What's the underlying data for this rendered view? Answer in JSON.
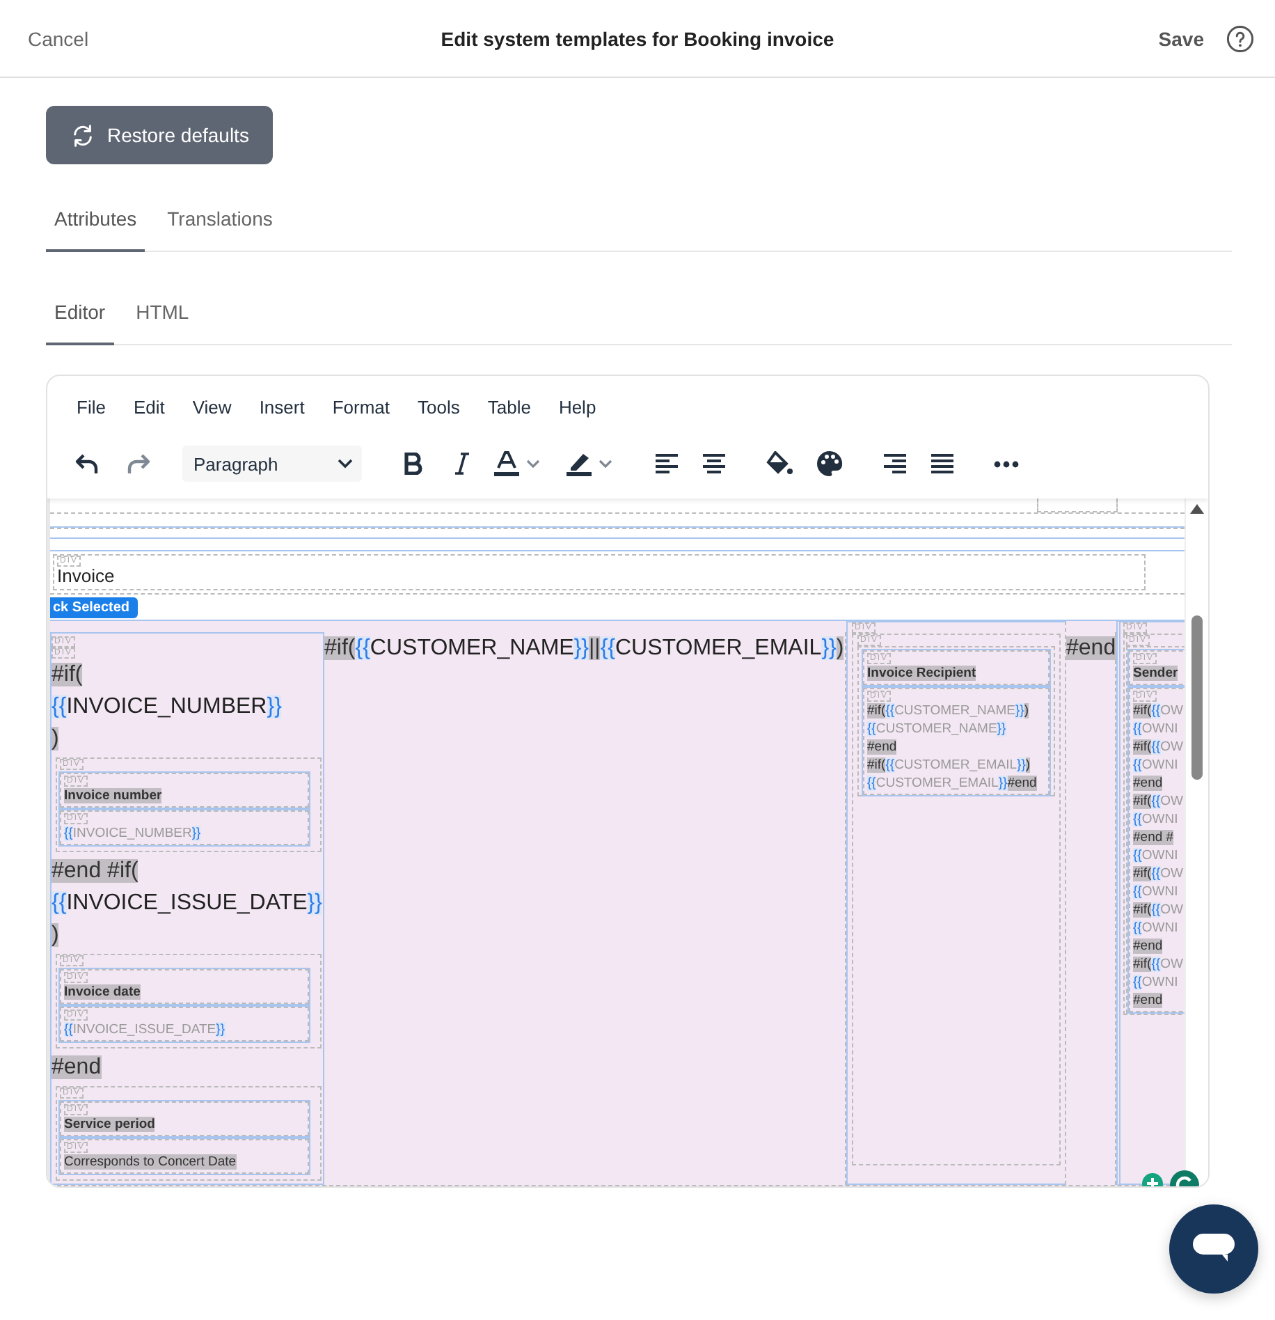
{
  "header": {
    "cancel": "Cancel",
    "title": "Edit system templates for Booking invoice",
    "save": "Save"
  },
  "restore_button": "Restore defaults",
  "section_tabs": [
    {
      "label": "Attributes",
      "selected": true
    },
    {
      "label": "Translations",
      "selected": false
    }
  ],
  "editor_tabs": [
    {
      "label": "Editor",
      "selected": true
    },
    {
      "label": "HTML",
      "selected": false
    }
  ],
  "editor": {
    "menu": [
      "File",
      "Edit",
      "View",
      "Insert",
      "Format",
      "Tools",
      "Table",
      "Help"
    ],
    "block_format": "Paragraph",
    "selection_badge": "ck Selected",
    "title_block": {
      "tag": "DIV",
      "text": "Invoice"
    },
    "left_tags": [
      "DIV",
      "DIV"
    ],
    "left_column": [
      {
        "kind": "line",
        "parts": [
          {
            "kind": "code",
            "text": "#if("
          }
        ]
      },
      {
        "kind": "line",
        "parts": [
          {
            "kind": "brace",
            "text": "{{"
          },
          {
            "kind": "var",
            "text": "INVOICE_NUMBER"
          },
          {
            "kind": "brace",
            "text": "}}"
          }
        ]
      },
      {
        "kind": "line",
        "parts": [
          {
            "kind": "code",
            "text": ")"
          }
        ]
      },
      {
        "kind": "group",
        "tag": "DIV",
        "fields": [
          {
            "kind": "label",
            "tag": "DIV",
            "lines": [
              [
                {
                  "kind": "code",
                  "text": "Invoice number"
                }
              ]
            ]
          },
          {
            "kind": "value",
            "tag": "DIV",
            "lines": [
              [
                {
                  "kind": "brace",
                  "text": "{{"
                },
                {
                  "kind": "var",
                  "text": "INVOICE_NUMBER"
                },
                {
                  "kind": "brace",
                  "text": "}}"
                }
              ]
            ]
          }
        ]
      },
      {
        "kind": "line",
        "parts": [
          {
            "kind": "code",
            "text": "#end #if("
          }
        ]
      },
      {
        "kind": "line",
        "parts": [
          {
            "kind": "brace",
            "text": "{{"
          },
          {
            "kind": "var",
            "text": "INVOICE_ISSUE_DATE"
          },
          {
            "kind": "brace",
            "text": "}}"
          }
        ]
      },
      {
        "kind": "line",
        "parts": [
          {
            "kind": "code",
            "text": ")"
          }
        ]
      },
      {
        "kind": "group",
        "tag": "DIV",
        "fields": [
          {
            "kind": "label",
            "tag": "DIV",
            "lines": [
              [
                {
                  "kind": "code",
                  "text": "Invoice date"
                }
              ]
            ]
          },
          {
            "kind": "value",
            "tag": "DIV",
            "lines": [
              [
                {
                  "kind": "brace",
                  "text": "{{"
                },
                {
                  "kind": "var",
                  "text": "INVOICE_ISSUE_DATE"
                },
                {
                  "kind": "brace",
                  "text": "}}"
                }
              ]
            ]
          }
        ]
      },
      {
        "kind": "line",
        "parts": [
          {
            "kind": "code",
            "text": "#end"
          }
        ]
      },
      {
        "kind": "group",
        "tag": "DIV",
        "fields": [
          {
            "kind": "label",
            "tag": "DIV",
            "lines": [
              [
                {
                  "kind": "code",
                  "text": "Service period"
                }
              ]
            ]
          },
          {
            "kind": "value",
            "tag": "DIV",
            "lines": [
              [
                {
                  "kind": "code",
                  "text": "Corresponds to Concert Date"
                }
              ]
            ]
          }
        ]
      }
    ],
    "middle_line": [
      {
        "kind": "code",
        "text": "#if("
      },
      {
        "kind": "brace",
        "text": "{{"
      },
      {
        "kind": "var",
        "text": "CUSTOMER_NAME"
      },
      {
        "kind": "brace",
        "text": "}}"
      },
      {
        "kind": "code",
        "text": "||"
      },
      {
        "kind": "brace",
        "text": "{{"
      },
      {
        "kind": "var",
        "text": "CUSTOMER_EMAIL"
      },
      {
        "kind": "brace",
        "text": "}}"
      },
      {
        "kind": "code",
        "text": ")"
      }
    ],
    "recipient": {
      "tags": [
        "DIV",
        "DIV"
      ],
      "fields": [
        {
          "kind": "label",
          "tag": "DIV",
          "lines": [
            [
              {
                "kind": "code",
                "text": "Invoice Recipient"
              }
            ]
          ]
        },
        {
          "kind": "value",
          "tag": "DIV",
          "lines": [
            [
              {
                "kind": "code",
                "text": "#if("
              },
              {
                "kind": "brace",
                "text": "{{"
              },
              {
                "kind": "var",
                "text": "CUSTOMER_NAME"
              },
              {
                "kind": "brace",
                "text": "}}"
              },
              {
                "kind": "code",
                "text": ")"
              }
            ],
            [
              {
                "kind": "brace",
                "text": "{{"
              },
              {
                "kind": "var",
                "text": "CUSTOMER_NAME"
              },
              {
                "kind": "brace",
                "text": "}}"
              }
            ],
            [
              {
                "kind": "code",
                "text": "#end"
              }
            ],
            [
              {
                "kind": "code",
                "text": "#if("
              },
              {
                "kind": "brace",
                "text": "{{"
              },
              {
                "kind": "var",
                "text": "CUSTOMER_EMAIL"
              },
              {
                "kind": "brace",
                "text": "}}"
              },
              {
                "kind": "code",
                "text": ")"
              }
            ],
            [
              {
                "kind": "brace",
                "text": "{{"
              },
              {
                "kind": "var",
                "text": "CUSTOMER_EMAIL"
              },
              {
                "kind": "brace",
                "text": "}}"
              },
              {
                "kind": "code",
                "text": "#end"
              }
            ]
          ]
        }
      ]
    },
    "end_line": [
      {
        "kind": "code",
        "text": "#end"
      }
    ],
    "sender": {
      "tags": [
        "DIV",
        "DIV"
      ],
      "fields": [
        {
          "kind": "label",
          "tag": "DIV",
          "lines": [
            [
              {
                "kind": "code",
                "text": "Sender"
              }
            ]
          ]
        },
        {
          "kind": "value",
          "tag": "DIV",
          "lines": [
            [
              {
                "kind": "code",
                "text": "#if("
              },
              {
                "kind": "brace",
                "text": "{{"
              },
              {
                "kind": "var",
                "text": "OW"
              }
            ],
            [
              {
                "kind": "brace",
                "text": "{{"
              },
              {
                "kind": "var",
                "text": "OWNI"
              }
            ],
            [
              {
                "kind": "code",
                "text": "#if("
              },
              {
                "kind": "brace",
                "text": "{{"
              },
              {
                "kind": "var",
                "text": "OW"
              }
            ],
            [
              {
                "kind": "brace",
                "text": "{{"
              },
              {
                "kind": "var",
                "text": "OWNI"
              }
            ],
            [
              {
                "kind": "code",
                "text": "#end"
              }
            ],
            [
              {
                "kind": "code",
                "text": "#if("
              },
              {
                "kind": "brace",
                "text": "{{"
              },
              {
                "kind": "var",
                "text": "OW"
              }
            ],
            [
              {
                "kind": "brace",
                "text": "{{"
              },
              {
                "kind": "var",
                "text": "OWNI"
              }
            ],
            [
              {
                "kind": "code",
                "text": "#end #"
              }
            ],
            [
              {
                "kind": "brace",
                "text": "{{"
              },
              {
                "kind": "var",
                "text": "OWNI"
              }
            ],
            [
              {
                "kind": "code",
                "text": "#if("
              },
              {
                "kind": "brace",
                "text": "{{"
              },
              {
                "kind": "var",
                "text": "OW"
              }
            ],
            [
              {
                "kind": "brace",
                "text": "{{"
              },
              {
                "kind": "var",
                "text": "OWNI"
              }
            ],
            [
              {
                "kind": "code",
                "text": "#if("
              },
              {
                "kind": "brace",
                "text": "{{"
              },
              {
                "kind": "var",
                "text": "OW"
              }
            ],
            [
              {
                "kind": "brace",
                "text": "{{"
              },
              {
                "kind": "var",
                "text": "OWNI"
              }
            ],
            [
              {
                "kind": "code",
                "text": "#end"
              }
            ],
            [
              {
                "kind": "code",
                "text": "#if("
              },
              {
                "kind": "brace",
                "text": "{{"
              },
              {
                "kind": "var",
                "text": "OW"
              }
            ],
            [
              {
                "kind": "brace",
                "text": "{{"
              },
              {
                "kind": "var",
                "text": "OWNI"
              }
            ],
            [
              {
                "kind": "code",
                "text": "#end"
              }
            ]
          ]
        }
      ]
    }
  }
}
